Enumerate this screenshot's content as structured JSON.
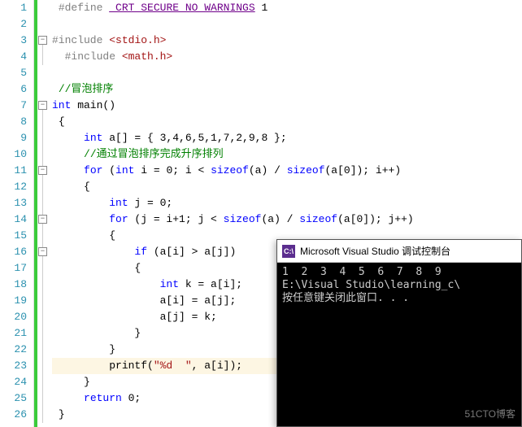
{
  "lines": {
    "l1_define": "#define",
    "l1_macro": "_CRT_SECURE_NO_WARNINGS",
    "l1_val": " 1",
    "l3_inc": "#include ",
    "l3_hdr": "<stdio.h>",
    "l4_inc": "#include ",
    "l4_hdr": "<math.h>",
    "l6_com": "//冒泡排序",
    "l7_int": "int",
    "l7_main": " main()",
    "l8_brace": "{",
    "l9_int": "int",
    "l9_rest": " a[] = { 3,4,6,5,1,7,2,9,8 };",
    "l10_com": "//通过冒泡排序完成升序排列",
    "l11_for": "for",
    "l11_a": " (",
    "l11_int": "int",
    "l11_b": " i = 0; i < ",
    "l11_sz1": "sizeof",
    "l11_c": "(a) / ",
    "l11_sz2": "sizeof",
    "l11_d": "(a[0]); i++)",
    "l12_brace": "{",
    "l13_int": "int",
    "l13_rest": " j = 0;",
    "l14_for": "for",
    "l14_a": " (j = i+1; j < ",
    "l14_sz1": "sizeof",
    "l14_b": "(a) / ",
    "l14_sz2": "sizeof",
    "l14_c": "(a[0]); j++)",
    "l15_brace": "{",
    "l16_if": "if",
    "l16_rest": " (a[i] > a[j])",
    "l17_brace": "{",
    "l18_int": "int",
    "l18_rest": " k = a[i];",
    "l19": "a[i] = a[j];",
    "l20": "a[j] = k;",
    "l21_brace": "}",
    "l22_brace": "}",
    "l23_printf": "printf(",
    "l23_str": "\"%d  \"",
    "l23_rest": ", a[i]);",
    "l24_brace": "}",
    "l25_ret": "return",
    "l25_rest": " 0;",
    "l26_brace": "}"
  },
  "line_numbers": [
    "1",
    "2",
    "3",
    "4",
    "5",
    "6",
    "7",
    "8",
    "9",
    "10",
    "11",
    "12",
    "13",
    "14",
    "15",
    "16",
    "17",
    "18",
    "19",
    "20",
    "21",
    "22",
    "23",
    "24",
    "25",
    "26"
  ],
  "console": {
    "title": "Microsoft Visual Studio 调试控制台",
    "icon": "C:\\",
    "out1": "1  2  3  4  5  6  7  8  9",
    "out2": "E:\\Visual Studio\\learning_c\\",
    "out3": "按任意键关闭此窗口. . ."
  },
  "watermark": "51CTO博客"
}
